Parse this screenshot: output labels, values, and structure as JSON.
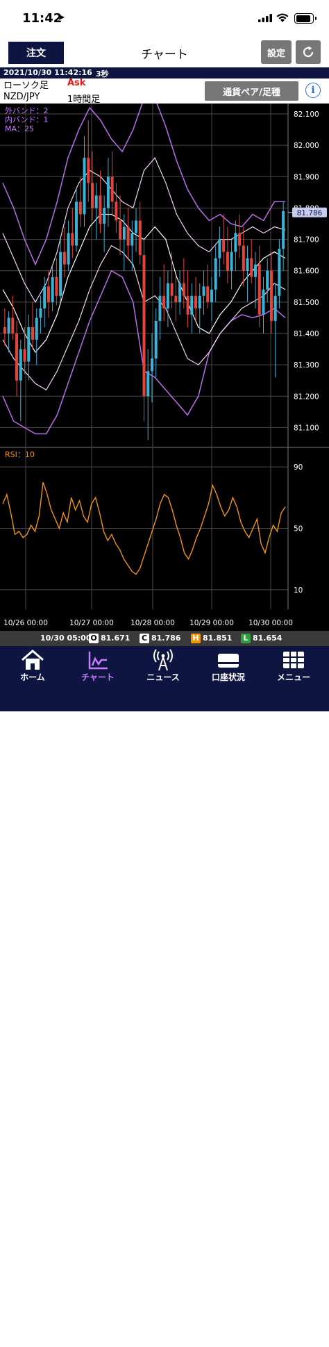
{
  "status": {
    "time": "11:42"
  },
  "nav": {
    "order_label": "注文",
    "title": "チャート",
    "settings_label": "設定"
  },
  "info": {
    "datetime": "2021/10/30 11:42:16",
    "interval": "3秒"
  },
  "chart_settings": {
    "chart_type": "ローソク足",
    "price_side": "Ask",
    "pair": "NZD/JPY",
    "timeframe": "1時間足",
    "pair_button": "通貨ペア/足種"
  },
  "indicators": {
    "outer_band": "外バンド：2",
    "inner_band": "内バンド：1",
    "ma": "MA：25",
    "rsi": "RSI：10"
  },
  "current_price": "81.786",
  "chart_data": {
    "type": "candlestick",
    "price_axis": [
      "82.100",
      "82.000",
      "81.900",
      "81.800",
      "81.700",
      "81.600",
      "81.500",
      "81.400",
      "81.300",
      "81.200",
      "81.100"
    ],
    "rsi_axis": [
      "90",
      "50",
      "10"
    ],
    "x_labels": [
      "10/26 00:00",
      "10/27 00:00",
      "10/28 00:00",
      "10/29 00:00",
      "10/30 00:00"
    ],
    "ylim": [
      81.05,
      82.12
    ],
    "rsi_ylim": [
      0,
      100
    ],
    "colors": {
      "up": "#3ab3d6",
      "down": "#e2453c",
      "outer": "#b96ee8",
      "inner": "#f2d6f5",
      "ma": "#ffffff",
      "rsi": "#f0960a",
      "grid": "#4a4a4a"
    },
    "candles": [
      [
        81.42,
        81.48,
        81.36,
        81.4
      ],
      [
        81.4,
        81.47,
        81.34,
        81.45
      ],
      [
        81.45,
        81.52,
        81.38,
        81.4
      ],
      [
        81.4,
        81.44,
        81.2,
        81.25
      ],
      [
        81.25,
        81.38,
        81.12,
        81.35
      ],
      [
        81.35,
        81.42,
        81.27,
        81.31
      ],
      [
        81.31,
        81.46,
        81.25,
        81.42
      ],
      [
        81.42,
        81.5,
        81.35,
        81.38
      ],
      [
        81.38,
        81.48,
        81.3,
        81.45
      ],
      [
        81.45,
        81.52,
        81.4,
        81.48
      ],
      [
        81.48,
        81.58,
        81.42,
        81.55
      ],
      [
        81.55,
        81.6,
        81.45,
        81.5
      ],
      [
        81.5,
        81.62,
        81.47,
        81.58
      ],
      [
        81.58,
        81.64,
        81.49,
        81.52
      ],
      [
        81.52,
        81.7,
        81.5,
        81.66
      ],
      [
        81.66,
        81.74,
        81.58,
        81.62
      ],
      [
        81.62,
        81.76,
        81.6,
        81.72
      ],
      [
        81.72,
        81.8,
        81.64,
        81.68
      ],
      [
        81.68,
        81.86,
        81.66,
        81.82
      ],
      [
        81.82,
        81.9,
        81.74,
        81.78
      ],
      [
        81.78,
        82.03,
        81.74,
        81.96
      ],
      [
        81.96,
        82.08,
        81.82,
        81.88
      ],
      [
        81.88,
        81.98,
        81.76,
        81.8
      ],
      [
        81.8,
        81.88,
        81.7,
        81.84
      ],
      [
        81.84,
        81.92,
        81.72,
        81.75
      ],
      [
        81.75,
        81.84,
        81.66,
        81.8
      ],
      [
        81.8,
        81.96,
        81.74,
        81.9
      ],
      [
        81.9,
        81.98,
        81.78,
        81.82
      ],
      [
        81.82,
        81.88,
        81.72,
        81.76
      ],
      [
        81.76,
        81.84,
        81.65,
        81.7
      ],
      [
        81.7,
        81.78,
        81.6,
        81.74
      ],
      [
        81.74,
        81.8,
        81.64,
        81.68
      ],
      [
        81.68,
        81.76,
        81.6,
        81.72
      ],
      [
        81.72,
        81.8,
        81.66,
        81.76
      ],
      [
        81.76,
        81.82,
        81.62,
        81.65
      ],
      [
        81.65,
        81.7,
        81.12,
        81.2
      ],
      [
        81.2,
        81.35,
        81.06,
        81.28
      ],
      [
        81.28,
        81.4,
        81.18,
        81.32
      ],
      [
        81.32,
        81.48,
        81.26,
        81.44
      ],
      [
        81.44,
        81.58,
        81.38,
        81.52
      ],
      [
        81.52,
        81.62,
        81.44,
        81.48
      ],
      [
        81.48,
        81.6,
        81.42,
        81.56
      ],
      [
        81.56,
        81.66,
        81.48,
        81.52
      ],
      [
        81.52,
        81.58,
        81.44,
        81.5
      ],
      [
        81.5,
        81.6,
        81.46,
        81.56
      ],
      [
        81.56,
        81.64,
        81.48,
        81.52
      ],
      [
        81.52,
        81.6,
        81.42,
        81.46
      ],
      [
        81.46,
        81.56,
        81.4,
        81.52
      ],
      [
        81.52,
        81.58,
        81.44,
        81.48
      ],
      [
        81.48,
        81.56,
        81.4,
        81.52
      ],
      [
        81.52,
        81.6,
        81.46,
        81.55
      ],
      [
        81.55,
        81.62,
        81.48,
        81.5
      ],
      [
        81.5,
        81.58,
        81.44,
        81.54
      ],
      [
        81.54,
        81.68,
        81.5,
        81.64
      ],
      [
        81.64,
        81.74,
        81.58,
        81.7
      ],
      [
        81.7,
        81.78,
        81.62,
        81.66
      ],
      [
        81.66,
        81.74,
        81.56,
        81.6
      ],
      [
        81.6,
        81.7,
        81.54,
        81.66
      ],
      [
        81.66,
        81.76,
        81.6,
        81.72
      ],
      [
        81.72,
        81.78,
        81.64,
        81.68
      ],
      [
        81.68,
        81.74,
        81.55,
        81.6
      ],
      [
        81.6,
        81.68,
        81.5,
        81.64
      ],
      [
        81.64,
        81.7,
        81.56,
        81.58
      ],
      [
        81.58,
        81.66,
        81.48,
        81.62
      ],
      [
        81.62,
        81.68,
        81.42,
        81.46
      ],
      [
        81.46,
        81.58,
        81.4,
        81.54
      ],
      [
        81.54,
        81.64,
        81.5,
        81.6
      ],
      [
        81.6,
        81.66,
        81.4,
        81.44
      ],
      [
        81.44,
        81.56,
        81.26,
        81.52
      ],
      [
        81.52,
        81.7,
        81.48,
        81.67
      ],
      [
        81.67,
        81.82,
        81.6,
        81.79
      ]
    ],
    "outer_upper": [
      81.88,
      81.8,
      81.7,
      81.62,
      81.7,
      81.82,
      81.96,
      82.05,
      82.12,
      82.08,
      82.02,
      81.98,
      82.05,
      82.15,
      82.15,
      82.06,
      81.95,
      81.86,
      81.8,
      81.76,
      81.78,
      81.75,
      81.74,
      81.78,
      81.76,
      81.82,
      81.82
    ],
    "inner_upper": [
      81.72,
      81.64,
      81.56,
      81.5,
      81.56,
      81.66,
      81.8,
      81.88,
      81.92,
      81.9,
      81.86,
      81.82,
      81.8,
      81.92,
      81.96,
      81.88,
      81.78,
      81.72,
      81.68,
      81.66,
      81.7,
      81.7,
      81.72,
      81.74,
      81.72,
      81.74,
      81.73
    ],
    "ma": [
      81.54,
      81.48,
      81.4,
      81.34,
      81.38,
      81.46,
      81.58,
      81.66,
      81.74,
      81.78,
      81.78,
      81.76,
      81.72,
      81.7,
      81.74,
      81.7,
      81.58,
      81.5,
      81.42,
      81.4,
      81.46,
      81.5,
      81.56,
      81.6,
      81.64,
      81.66,
      81.64
    ],
    "inner_lower": [
      81.38,
      81.32,
      81.28,
      81.24,
      81.22,
      81.28,
      81.36,
      81.44,
      81.54,
      81.62,
      81.68,
      81.66,
      81.62,
      81.5,
      81.52,
      81.48,
      81.4,
      81.32,
      81.3,
      81.34,
      81.4,
      81.44,
      81.48,
      81.5,
      81.52,
      81.56,
      81.54
    ],
    "outer_lower": [
      81.2,
      81.12,
      81.1,
      81.08,
      81.08,
      81.14,
      81.24,
      81.34,
      81.44,
      81.52,
      81.6,
      81.58,
      81.5,
      81.28,
      81.26,
      81.22,
      81.18,
      81.14,
      81.2,
      81.34,
      81.4,
      81.44,
      81.46,
      81.45,
      81.46,
      81.48,
      81.45
    ],
    "rsi": [
      66,
      72,
      60,
      46,
      48,
      44,
      46,
      52,
      48,
      58,
      80,
      72,
      62,
      56,
      50,
      60,
      54,
      70,
      62,
      68,
      58,
      54,
      66,
      70,
      60,
      48,
      42,
      46,
      40,
      36,
      30,
      26,
      22,
      20,
      24,
      32,
      40,
      48,
      56,
      66,
      72,
      70,
      62,
      52,
      44,
      34,
      30,
      36,
      44,
      50,
      58,
      66,
      78,
      72,
      64,
      58,
      62,
      70,
      64,
      54,
      48,
      44,
      50,
      56,
      40,
      34,
      44,
      52,
      48,
      60,
      64
    ]
  },
  "ohlc_bar": {
    "time": "10/30 05:00",
    "o_label": "O",
    "o": "81.671",
    "c_label": "C",
    "c": "81.786",
    "h_label": "H",
    "h": "81.851",
    "l_label": "L",
    "l": "81.654"
  },
  "tabs": [
    {
      "label": "ホーム"
    },
    {
      "label": "チャート"
    },
    {
      "label": "ニュース"
    },
    {
      "label": "口座状況"
    },
    {
      "label": "メニュー"
    }
  ]
}
